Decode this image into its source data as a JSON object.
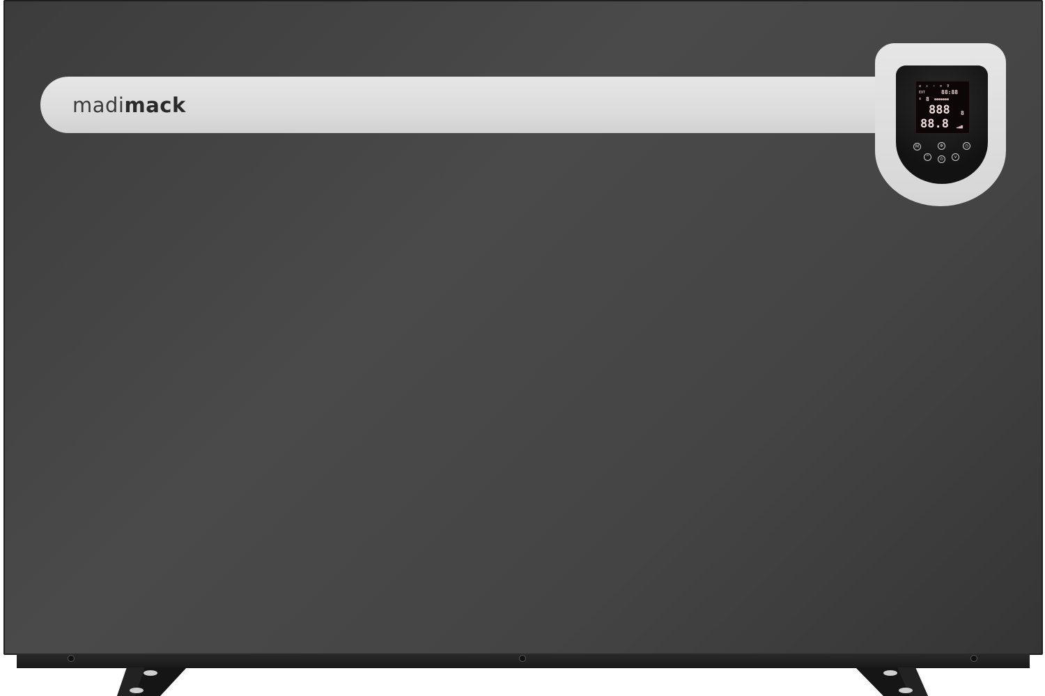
{
  "brand": {
    "light_part": "madi",
    "bold_part": "mack"
  },
  "display": {
    "top_label": "EXT",
    "clock": "88:88",
    "main_reading": "888",
    "sub_reading": "88.8",
    "small_digit": "8"
  },
  "controls": {
    "mode_button": "M",
    "fan_button": "✲",
    "timer_button": "◷",
    "up_button": "^",
    "power_button": "⏻",
    "down_button": "v"
  },
  "colors": {
    "body": "#444444",
    "band": "#dcdcdc",
    "panel": "#141414"
  }
}
